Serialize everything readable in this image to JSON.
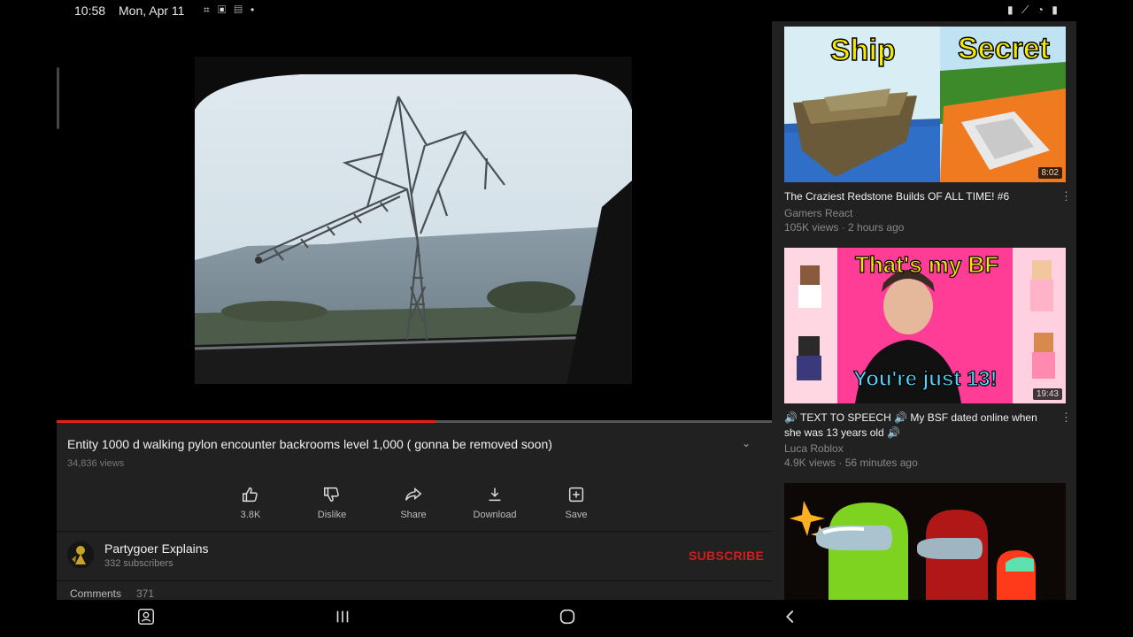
{
  "status_bar": {
    "time": "10:58",
    "date": "Mon, Apr 11",
    "notification_icons": "⌗ ▣ ▤ •",
    "system_icons": "▮ ⟋ ◔ ▮"
  },
  "player": {
    "progress_fraction": 0.53,
    "accent": "#e62117"
  },
  "video": {
    "title": "Entity 1000 d walking pylon encounter backrooms level 1,000 ( gonna be removed soon)",
    "views": "34,836 views",
    "expand_icon": "chevron-down-icon"
  },
  "actions": [
    {
      "id": "like",
      "label": "3.8K",
      "icon": "thumbs-up-icon"
    },
    {
      "id": "dislike",
      "label": "Dislike",
      "icon": "thumbs-down-icon"
    },
    {
      "id": "share",
      "label": "Share",
      "icon": "share-icon"
    },
    {
      "id": "download",
      "label": "Download",
      "icon": "download-icon"
    },
    {
      "id": "save",
      "label": "Save",
      "icon": "save-icon"
    }
  ],
  "channel": {
    "name": "Partygoer Explains",
    "subscribers": "332 subscribers",
    "subscribe_label": "SUBSCRIBE",
    "subscribe_color": "#cc1f1f"
  },
  "comments": {
    "label": "Comments",
    "count": "371"
  },
  "related": [
    {
      "title": "The Craziest Redstone Builds OF ALL TIME! #6",
      "channel": "Gamers React",
      "meta": "105K views · 2 hours ago",
      "duration": "8:02",
      "thumb_text_left": "Ship",
      "thumb_text_right": "Secret"
    },
    {
      "title": "🔊 TEXT TO SPEECH 🔊 My BSF dated online when she was 13 years old 🔊",
      "channel": "Luca Roblox",
      "meta": "4.9K views · 56 minutes ago",
      "duration": "19:43",
      "thumb_text_top": "That's my BF",
      "thumb_text_bottom": "You're just 13!"
    },
    {
      "title": "",
      "channel": "",
      "meta": "",
      "duration": ""
    }
  ],
  "navbar": {
    "recent_icon": "recent-apps-icon",
    "home_icon": "home-icon",
    "back_icon": "back-icon"
  }
}
